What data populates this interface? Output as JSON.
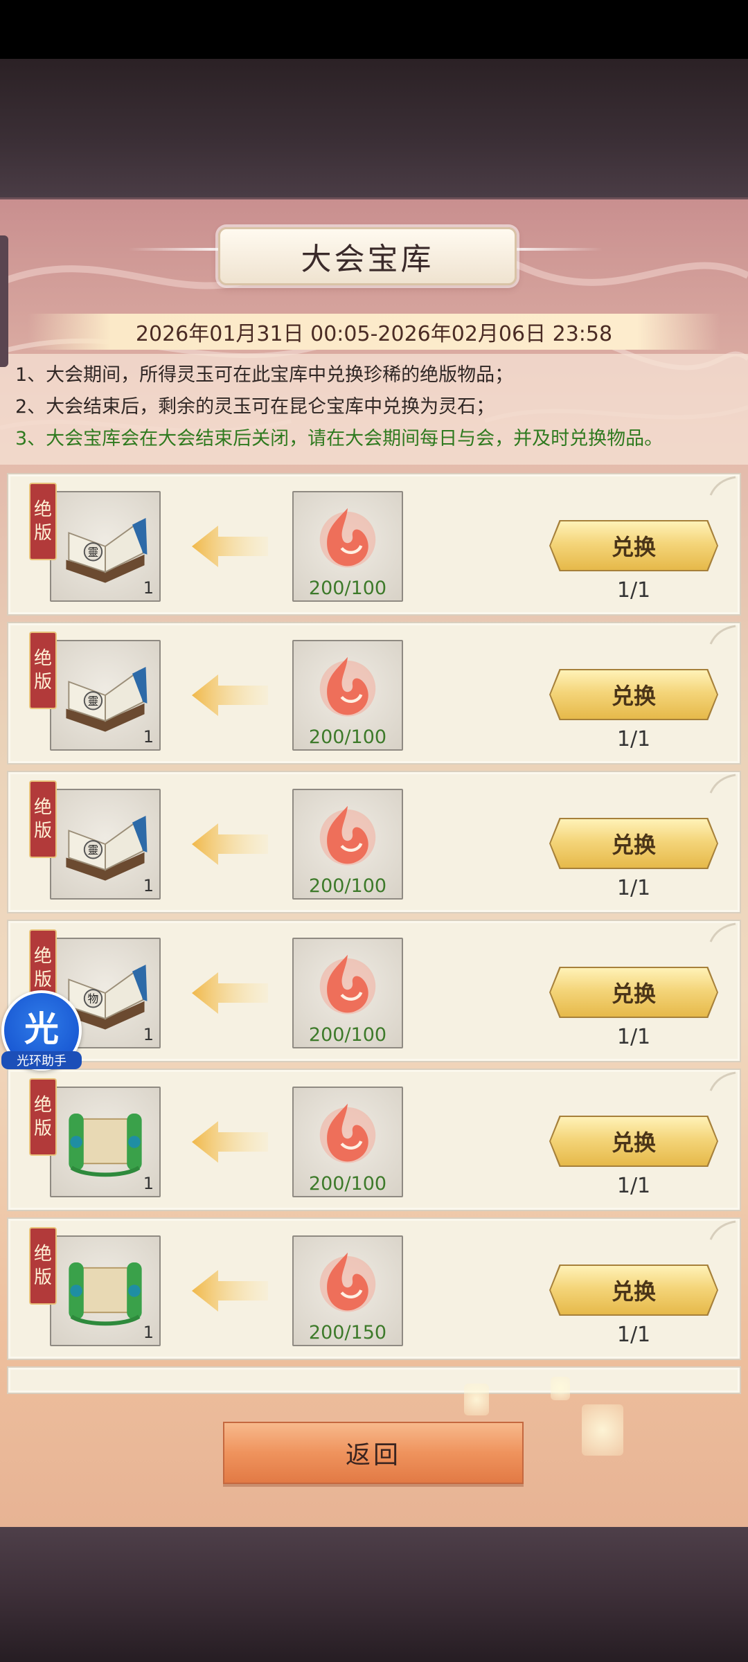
{
  "title": "大会宝库",
  "date_range": "2026年01月31日 00:05-2026年02月06日 23:58",
  "rules": [
    "1、大会期间，所得灵玉可在此宝库中兑换珍稀的绝版物品；",
    "2、大会结束后，剩余的灵玉可在昆仑宝库中兑换为灵石；",
    "3、大会宝库会在大会结束后关闭，请在大会期间每日与会，并及时兑换物品。"
  ],
  "rows": [
    {
      "tag": [
        "绝",
        "版"
      ],
      "item_icon": "book-icon",
      "item_char": "靈",
      "item_count": "1",
      "cost": "200/100",
      "button": "兑换",
      "limit": "1/1"
    },
    {
      "tag": [
        "绝",
        "版"
      ],
      "item_icon": "book-icon",
      "item_char": "靈",
      "item_count": "1",
      "cost": "200/100",
      "button": "兑换",
      "limit": "1/1"
    },
    {
      "tag": [
        "绝",
        "版"
      ],
      "item_icon": "book-icon",
      "item_char": "靈",
      "item_count": "1",
      "cost": "200/100",
      "button": "兑换",
      "limit": "1/1"
    },
    {
      "tag": [
        "绝",
        "版"
      ],
      "item_icon": "book-icon",
      "item_char": "物",
      "item_count": "1",
      "cost": "200/100",
      "button": "兑换",
      "limit": "1/1"
    },
    {
      "tag": [
        "绝",
        "版"
      ],
      "item_icon": "scroll-icon",
      "item_char": "",
      "item_count": "1",
      "cost": "200/100",
      "button": "兑换",
      "limit": "1/1"
    },
    {
      "tag": [
        "绝",
        "版"
      ],
      "item_icon": "scroll-icon",
      "item_char": "",
      "item_count": "1",
      "cost": "200/150",
      "button": "兑换",
      "limit": "1/1"
    }
  ],
  "back_label": "返回",
  "overlay": {
    "glyph": "光",
    "label": "光环助手"
  },
  "colors": {
    "cost_green": "#3d7a2a",
    "rule_green": "#2f7a1f",
    "tag_red": "#b23a3a",
    "button_gold": "#f4d57a"
  }
}
